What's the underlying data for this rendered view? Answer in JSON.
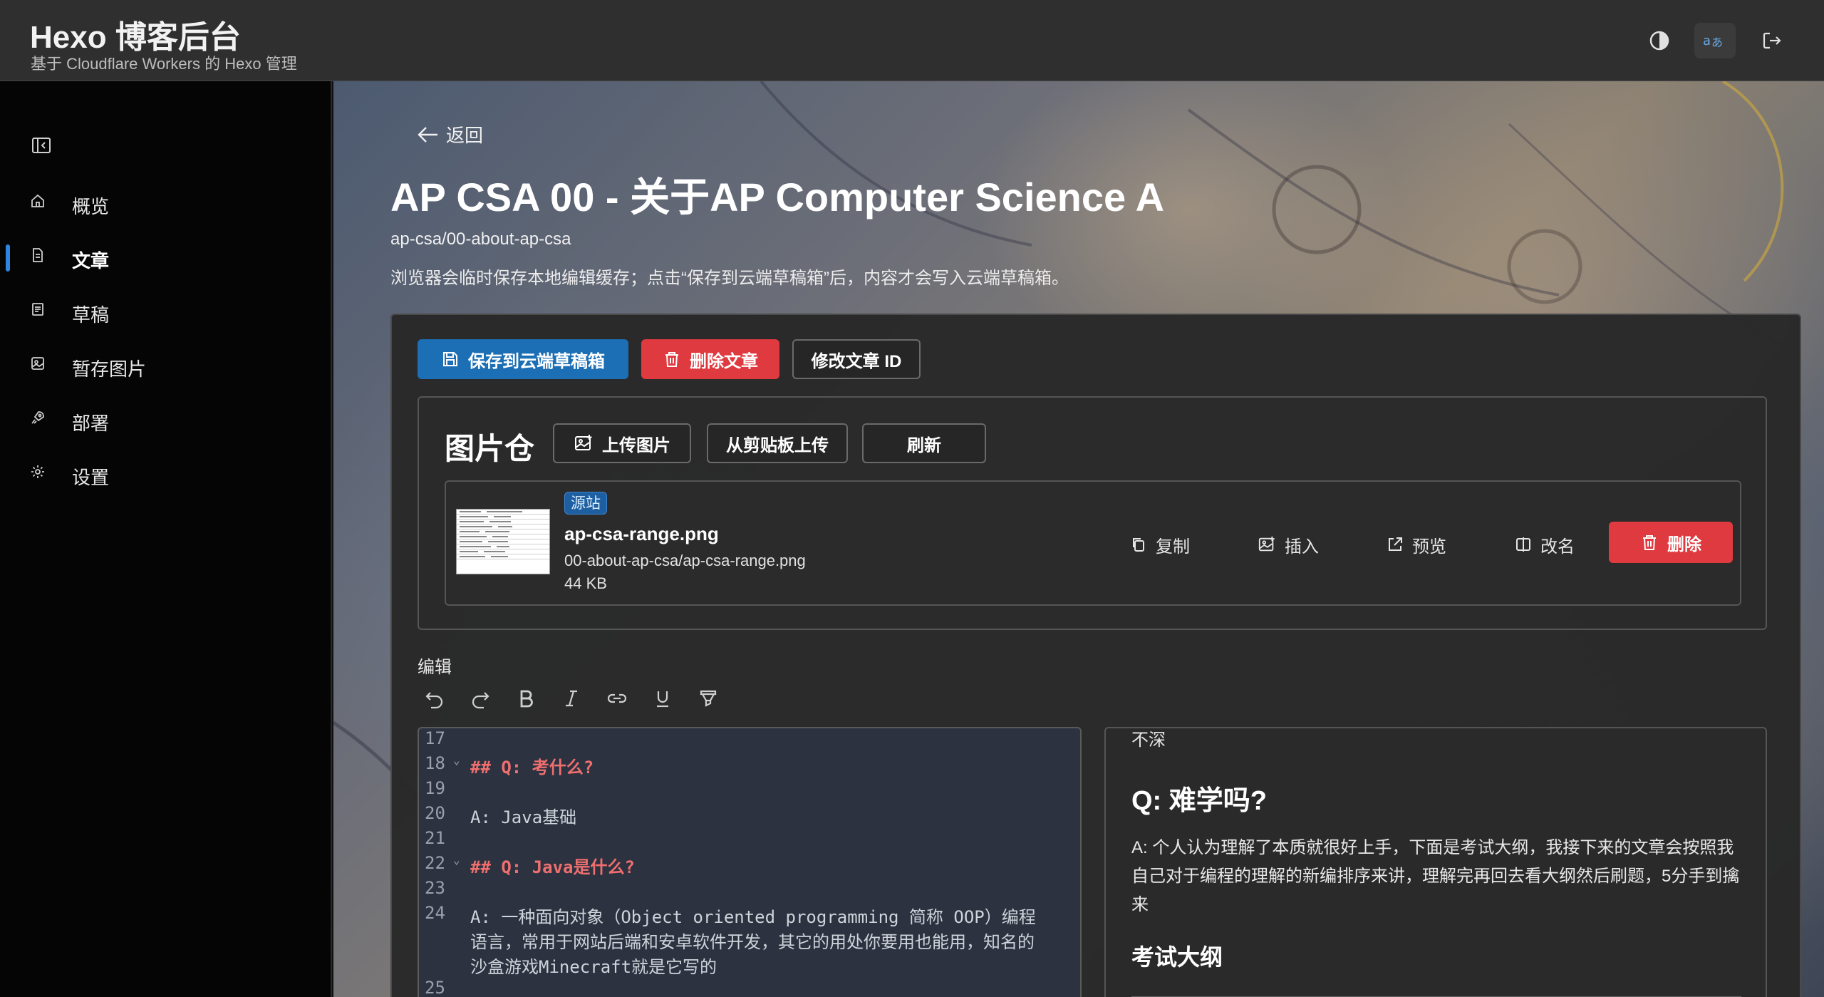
{
  "header": {
    "title": "Hexo 博客后台",
    "subtitle": "基于 Cloudflare Workers 的 Hexo 管理",
    "icons": [
      "contrast-icon",
      "translate-icon",
      "logout-icon"
    ]
  },
  "sidebar": {
    "items": [
      {
        "label": "概览",
        "icon": "home-icon"
      },
      {
        "label": "文章",
        "icon": "document-icon",
        "active": true
      },
      {
        "label": "草稿",
        "icon": "draft-icon"
      },
      {
        "label": "暂存图片",
        "icon": "image-icon"
      },
      {
        "label": "部署",
        "icon": "rocket-icon"
      },
      {
        "label": "设置",
        "icon": "gear-icon"
      }
    ]
  },
  "main": {
    "back_label": "返回",
    "post_title": "AP CSA 00 - 关于AP Computer Science A",
    "post_slug": "ap-csa/00-about-ap-csa",
    "note": "浏览器会临时保存本地编辑缓存；点击“保存到云端草稿箱”后，内容才会写入云端草稿箱。",
    "actions": {
      "save": "保存到云端草稿箱",
      "delete": "删除文章",
      "rename_id": "修改文章 ID"
    }
  },
  "image_store": {
    "title": "图片仓",
    "upload": "上传图片",
    "paste_upload": "从剪贴板上传",
    "refresh": "刷新",
    "items": [
      {
        "badge": "源站",
        "name": "ap-csa-range.png",
        "path": "00-about-ap-csa/ap-csa-range.png",
        "size": "44 KB",
        "actions": {
          "copy": "复制",
          "insert": "插入",
          "preview": "预览",
          "rename": "改名",
          "delete": "删除"
        }
      }
    ]
  },
  "editor": {
    "label": "编辑",
    "tools": [
      "undo-icon",
      "redo-icon",
      "bold-icon",
      "italic-icon",
      "link-icon",
      "underline-icon",
      "highlight-icon"
    ],
    "lines": [
      {
        "n": "17",
        "text": "",
        "heading": false,
        "fold": false
      },
      {
        "n": "18",
        "text": "## Q: 考什么?",
        "heading": true,
        "fold": true
      },
      {
        "n": "19",
        "text": "",
        "heading": false,
        "fold": false
      },
      {
        "n": "20",
        "text": "A: Java基础",
        "heading": false,
        "fold": false
      },
      {
        "n": "21",
        "text": "",
        "heading": false,
        "fold": false
      },
      {
        "n": "22",
        "text": "## Q: Java是什么?",
        "heading": true,
        "fold": true
      },
      {
        "n": "23",
        "text": "",
        "heading": false,
        "fold": false
      },
      {
        "n": "24",
        "text": "A: 一种面向对象（Object oriented programming 简称 OOP）编程",
        "heading": false,
        "fold": false
      },
      {
        "n": "",
        "text": "语言，常用于网站后端和安卓软件开发，其它的用处你要用也能用，知名的",
        "heading": false,
        "fold": false
      },
      {
        "n": "",
        "text": "沙盒游戏Minecraft就是它写的",
        "heading": false,
        "fold": false
      },
      {
        "n": "25",
        "text": "",
        "heading": false,
        "fold": false
      }
    ]
  },
  "preview": {
    "clipped_text": "不深",
    "h2": "Q: 难学吗?",
    "paragraph": "A: 个人认为理解了本质就很好上手，下面是考试大纲，我接下来的文章会按照我自己对于编程的理解的新编排序来讲，理解完再回去看大纲然后刷题，5分手到擒来",
    "h3": "考试大纲"
  }
}
